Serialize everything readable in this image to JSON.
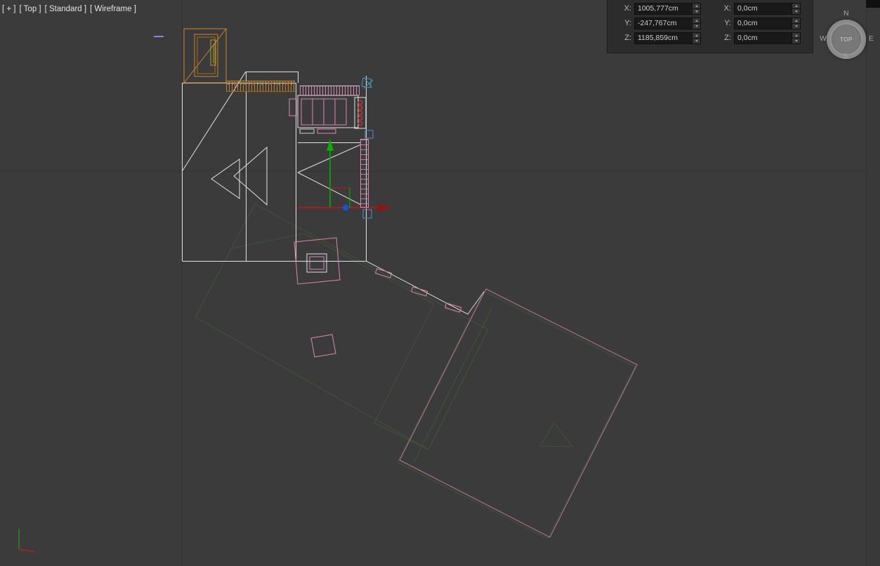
{
  "viewport": {
    "general": "[ + ]",
    "point_of_view": "[ Top ]",
    "shading_quality": "[ Standard ]",
    "shading": "[ Wireframe ]"
  },
  "transform_type_in": {
    "labels": {
      "x": "X:",
      "y": "Y:",
      "z": "Z:"
    },
    "absolute": {
      "x": "1005,777cm",
      "y": "-247,767cm",
      "z": "1185,859cm"
    },
    "offset": {
      "x": "0,0cm",
      "y": "0,0cm",
      "z": "0,0cm"
    }
  },
  "view_cube": {
    "north": "N",
    "west": "W",
    "east": "E",
    "south": "S",
    "face": "TOP"
  },
  "colors": {
    "background": "#3b3b3b",
    "grid_line": "#333333",
    "wireframe_white": "#e2e2e2",
    "wireframe_orange": "#c9842e",
    "wireframe_pink": "#de84b0",
    "wireframe_dark_green": "#3f5635",
    "gizmo_x_axis_red": "#c81414",
    "gizmo_y_axis_green": "#00b400",
    "gizmo_center_blue": "#1e4fd0",
    "selection_handle_blue": "#4d80c0",
    "panel_background": "#2c2c2c",
    "field_background": "#191919"
  }
}
